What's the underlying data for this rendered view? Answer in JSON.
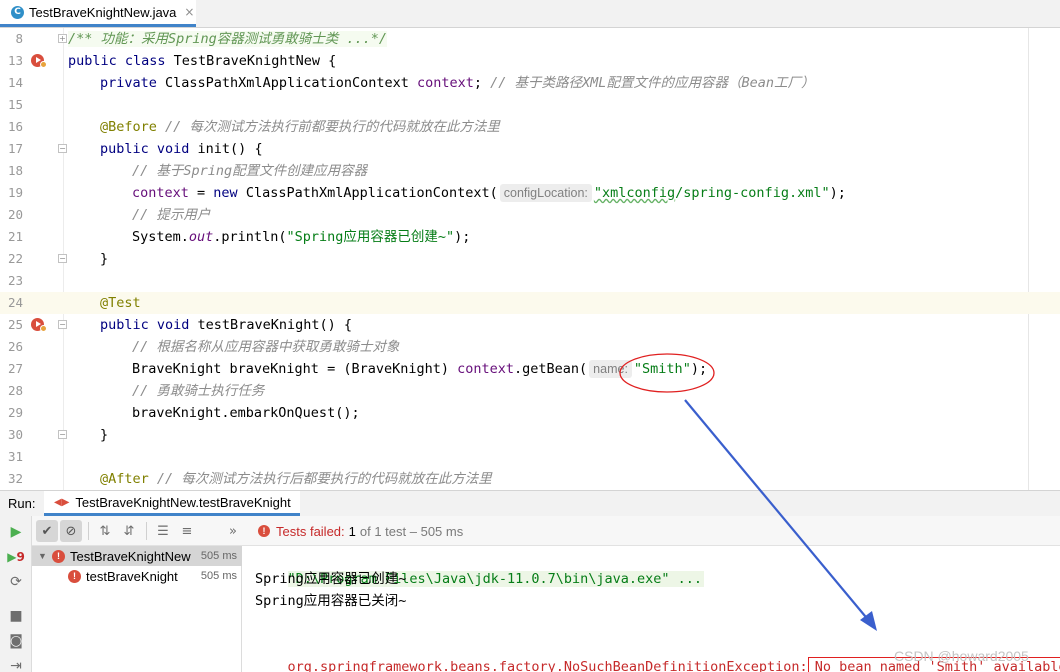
{
  "tab": {
    "icon": "java-class-icon",
    "title": "TestBraveKnightNew.java",
    "close": "×"
  },
  "editor": {
    "lines": [
      {
        "n": "8",
        "segments": [
          {
            "c": "doc",
            "t": "/** 功能：采用Spring容器测试勇敢骑士类 ...*/"
          }
        ],
        "indent": 0
      },
      {
        "n": "13",
        "segments": [
          {
            "c": "kw",
            "t": "public class "
          },
          {
            "c": "",
            "t": "TestBraveKnightNew {"
          }
        ],
        "indent": 0
      },
      {
        "n": "14",
        "segments": [
          {
            "c": "kw",
            "t": "private "
          },
          {
            "c": "",
            "t": "ClassPathXmlApplicationContext "
          },
          {
            "c": "fld",
            "t": "context"
          },
          {
            "c": "",
            "t": "; "
          },
          {
            "c": "cmt",
            "t": "// 基于类路径XML配置文件的应用容器（Bean工厂）"
          }
        ],
        "indent": 1
      },
      {
        "n": "15",
        "segments": [],
        "indent": 0
      },
      {
        "n": "16",
        "segments": [
          {
            "c": "ann",
            "t": "@Before "
          },
          {
            "c": "cmt",
            "t": "// 每次测试方法执行前都要执行的代码就放在此方法里"
          }
        ],
        "indent": 1
      },
      {
        "n": "17",
        "segments": [
          {
            "c": "kw",
            "t": "public void "
          },
          {
            "c": "",
            "t": "init() {"
          }
        ],
        "indent": 1
      },
      {
        "n": "18",
        "segments": [
          {
            "c": "cmt",
            "t": "// 基于Spring配置文件创建应用容器"
          }
        ],
        "indent": 2
      },
      {
        "n": "19",
        "segments": [
          {
            "c": "fld",
            "t": "context"
          },
          {
            "c": "",
            "t": " = "
          },
          {
            "c": "kw",
            "t": "new "
          },
          {
            "c": "",
            "t": "ClassPathXmlApplicationContext("
          },
          {
            "c": "hint",
            "t": "configLocation:"
          },
          {
            "c": "str-sq",
            "t": "\"xmlconfig"
          },
          {
            "c": "str",
            "t": "/spring-config.xml\""
          },
          {
            "c": "",
            "t": ");"
          }
        ],
        "indent": 2
      },
      {
        "n": "20",
        "segments": [
          {
            "c": "cmt",
            "t": "// 提示用户"
          }
        ],
        "indent": 2
      },
      {
        "n": "21",
        "segments": [
          {
            "c": "",
            "t": "System."
          },
          {
            "c": "static",
            "t": "out"
          },
          {
            "c": "",
            "t": ".println("
          },
          {
            "c": "str",
            "t": "\"Spring应用容器已创建~\""
          },
          {
            "c": "",
            "t": ");"
          }
        ],
        "indent": 2
      },
      {
        "n": "22",
        "segments": [
          {
            "c": "",
            "t": "}"
          }
        ],
        "indent": 1
      },
      {
        "n": "23",
        "segments": [],
        "indent": 0
      },
      {
        "n": "24",
        "segments": [
          {
            "c": "ann",
            "t": "@Test"
          }
        ],
        "indent": 1
      },
      {
        "n": "25",
        "segments": [
          {
            "c": "kw",
            "t": "public void "
          },
          {
            "c": "",
            "t": "testBraveKnight() {"
          }
        ],
        "indent": 1
      },
      {
        "n": "26",
        "segments": [
          {
            "c": "cmt",
            "t": "// 根据名称从应用容器中获取勇敢骑士对象"
          }
        ],
        "indent": 2
      },
      {
        "n": "27",
        "segments": [
          {
            "c": "",
            "t": "BraveKnight braveKnight = (BraveKnight) "
          },
          {
            "c": "fld",
            "t": "context"
          },
          {
            "c": "",
            "t": ".getBean("
          },
          {
            "c": "hint",
            "t": "name:"
          },
          {
            "c": "str",
            "t": "\"Smith\""
          },
          {
            "c": "",
            "t": ");"
          }
        ],
        "indent": 2
      },
      {
        "n": "28",
        "segments": [
          {
            "c": "cmt",
            "t": "// 勇敢骑士执行任务"
          }
        ],
        "indent": 2
      },
      {
        "n": "29",
        "segments": [
          {
            "c": "",
            "t": "braveKnight.embarkOnQuest();"
          }
        ],
        "indent": 2
      },
      {
        "n": "30",
        "segments": [
          {
            "c": "",
            "t": "}"
          }
        ],
        "indent": 1
      },
      {
        "n": "31",
        "segments": [],
        "indent": 0
      },
      {
        "n": "32",
        "segments": [
          {
            "c": "ann",
            "t": "@After "
          },
          {
            "c": "cmt",
            "t": "// 每次测试方法执行后都要执行的代码就放在此方法里"
          }
        ],
        "indent": 1
      }
    ]
  },
  "run": {
    "label": "Run:",
    "tab_title": "TestBraveKnightNew.testBraveKnight",
    "status": {
      "failed_label": "Tests failed:",
      "count": "1",
      "rest": "of 1 test – 505 ms"
    },
    "toolbar_more": "»",
    "tree": [
      {
        "name": "TestBraveKnightNew",
        "time": "505 ms"
      },
      {
        "name": "testBraveKnight",
        "time": "505 ms"
      }
    ],
    "console": {
      "cmd": "\"D:\\Program Files\\Java\\jdk-11.0.7\\bin\\java.exe\" ...",
      "out1": "Spring应用容器已创建~",
      "out2": "Spring应用容器已关闭~",
      "exception": "org.springframework.beans.factory.NoSuchBeanDefinitionException:",
      "message": "No bean named 'Smith' available"
    },
    "fail_badge": "9"
  },
  "watermark": "CSDN @howard2005",
  "colors": {
    "annotation_red": "#e02020",
    "arrow_blue": "#3a5fcd"
  }
}
